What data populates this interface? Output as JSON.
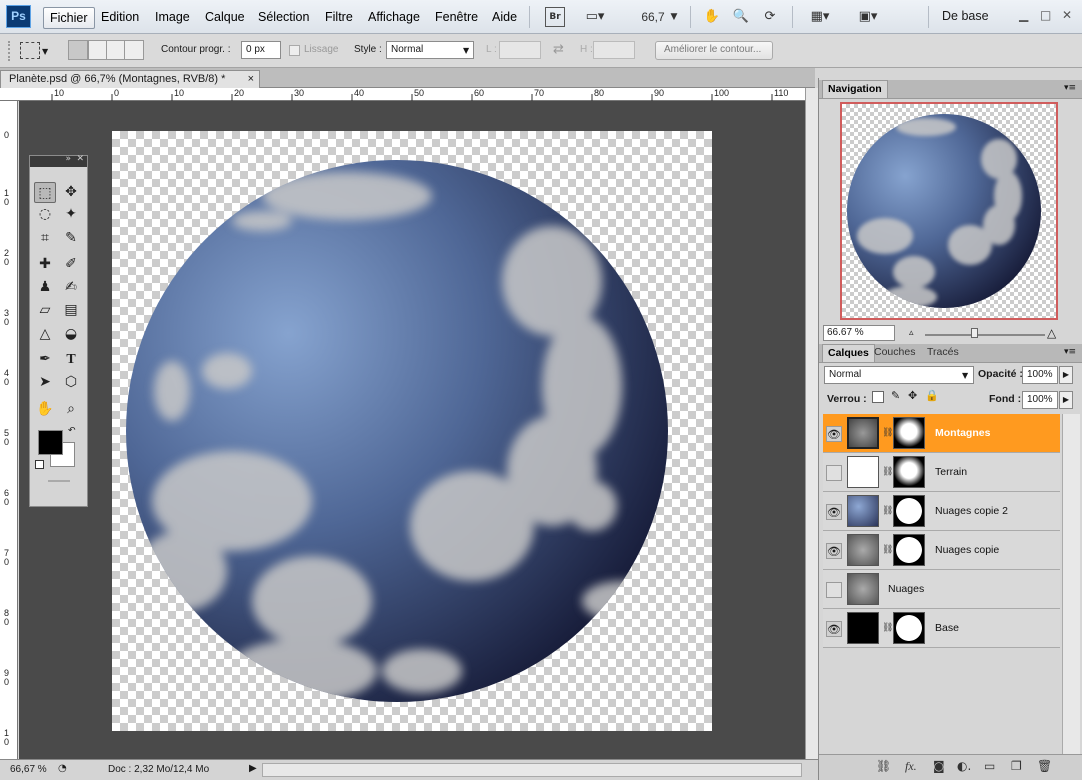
{
  "app": {
    "logo": "Ps"
  },
  "menu": [
    "Fichier",
    "Edition",
    "Image",
    "Calque",
    "Sélection",
    "Filtre",
    "Affichage",
    "Fenêtre",
    "Aide"
  ],
  "menubar": {
    "bridge": "Br",
    "zoom": "66,7",
    "workspace": "De base"
  },
  "options": {
    "contour_label": "Contour progr. :",
    "contour_value": "0 px",
    "lissage_label": "Lissage",
    "style_label": "Style :",
    "style_value": "Normal",
    "l_label": "L :",
    "h_label": "H :",
    "improve_button": "Améliorer le contour..."
  },
  "document": {
    "tab_title": "Planète.psd @ 66,7% (Montagnes, RVB/8) *",
    "close": "×"
  },
  "ruler": {
    "top": [
      "10",
      "0",
      "10",
      "20",
      "30",
      "40",
      "50",
      "60",
      "70",
      "80",
      "90",
      "100",
      "110"
    ],
    "left": [
      "0",
      "1\n0",
      "2\n0",
      "3\n0",
      "4\n0",
      "5\n0",
      "6\n0",
      "7\n0",
      "8\n0",
      "9\n0",
      "1\n0"
    ]
  },
  "status": {
    "zoom": "66,67 %",
    "doc": "Doc : 2,32 Mo/12,4 Mo"
  },
  "navigator": {
    "tab": "Navigation",
    "zoom": "66.67 %"
  },
  "layers_panel": {
    "tabs": [
      "Calques",
      "Couches",
      "Tracés"
    ],
    "blend_mode": "Normal",
    "opacity_label": "Opacité :",
    "opacity_value": "100%",
    "lock_label": "Verrou :",
    "fill_label": "Fond :",
    "fill_value": "100%",
    "layers": [
      {
        "name": "Montagnes",
        "visible": true,
        "selected": true,
        "mask": true
      },
      {
        "name": "Terrain",
        "visible": false,
        "selected": false,
        "mask": true
      },
      {
        "name": "Nuages copie 2",
        "visible": true,
        "selected": false,
        "mask": true
      },
      {
        "name": "Nuages copie",
        "visible": true,
        "selected": false,
        "mask": true
      },
      {
        "name": "Nuages",
        "visible": false,
        "selected": false,
        "mask": false
      },
      {
        "name": "Base",
        "visible": true,
        "selected": false,
        "mask": true
      }
    ]
  },
  "colors": {
    "selected_layer": "#ff9a1f",
    "planet": "#3a4d7a",
    "canvas_bg": "#4a4a4a"
  }
}
